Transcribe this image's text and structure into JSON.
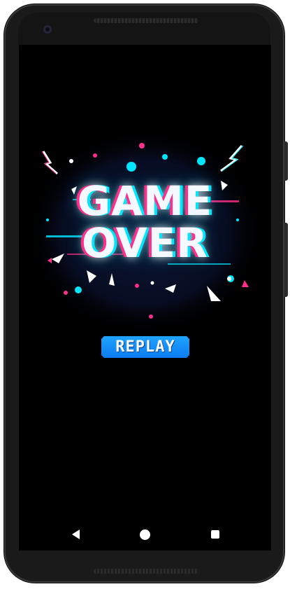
{
  "game": {
    "title_line1": "GAME",
    "title_line2": "OVER",
    "replay_label": "REPLAY"
  },
  "colors": {
    "screen_bg": "#000000",
    "glitch_pink": "#ff2e8a",
    "glitch_cyan": "#00e6ff",
    "replay_button": "#1596fb"
  },
  "icons": {
    "nav_back": "back-triangle-icon",
    "nav_home": "home-circle-icon",
    "nav_recents": "recents-square-icon"
  }
}
